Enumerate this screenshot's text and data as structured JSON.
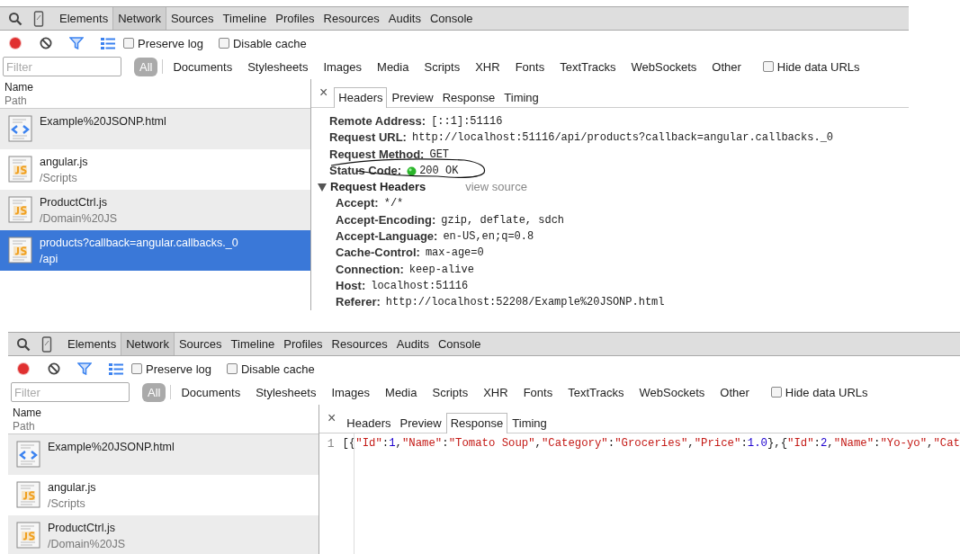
{
  "panels": [
    {
      "main_tabs": [
        {
          "label": "Elements",
          "selected": false
        },
        {
          "label": "Network",
          "selected": true
        },
        {
          "label": "Sources",
          "selected": false
        },
        {
          "label": "Timeline",
          "selected": false
        },
        {
          "label": "Profiles",
          "selected": false
        },
        {
          "label": "Resources",
          "selected": false
        },
        {
          "label": "Audits",
          "selected": false
        },
        {
          "label": "Console",
          "selected": false
        }
      ],
      "checkboxes": [
        {
          "label": "Preserve log",
          "checked": false
        },
        {
          "label": "Disable cache",
          "checked": false
        }
      ],
      "filter": {
        "placeholder": "Filter"
      },
      "type_filters": [
        {
          "label": "All",
          "selected": true
        },
        {
          "label": "Documents",
          "selected": false
        },
        {
          "label": "Stylesheets",
          "selected": false
        },
        {
          "label": "Images",
          "selected": false
        },
        {
          "label": "Media",
          "selected": false
        },
        {
          "label": "Scripts",
          "selected": false
        },
        {
          "label": "XHR",
          "selected": false
        },
        {
          "label": "Fonts",
          "selected": false
        },
        {
          "label": "TextTracks",
          "selected": false
        },
        {
          "label": "WebSockets",
          "selected": false
        },
        {
          "label": "Other",
          "selected": false
        }
      ],
      "hide_data_urls": {
        "label": "Hide data URLs",
        "checked": false
      },
      "list_header": {
        "name": "Name",
        "path": "Path"
      },
      "requests": [
        {
          "name": "Example%20JSONP.html",
          "kind": "html",
          "selected": false
        },
        {
          "name": "angular.js",
          "path": "/Scripts",
          "kind": "js",
          "selected": false
        },
        {
          "name": "ProductCtrl.js",
          "path": "/Domain%20JS",
          "kind": "js",
          "selected": false
        },
        {
          "name": "products?callback=angular.callbacks._0",
          "path": "/api",
          "kind": "js",
          "selected": true
        }
      ],
      "close": "×",
      "detail_tabs": [
        {
          "label": "Headers",
          "selected": true
        },
        {
          "label": "Preview",
          "selected": false
        },
        {
          "label": "Response",
          "selected": false
        },
        {
          "label": "Timing",
          "selected": false
        }
      ],
      "detail": {
        "kind": "headers",
        "general": [
          {
            "label": "Remote Address:",
            "value": "[::1]:51116"
          },
          {
            "label": "Request URL:",
            "value": "http://localhost:51116/api/products?callback=angular.callbacks._0"
          },
          {
            "label": "Request Method:",
            "value": "GET"
          },
          {
            "label": "Status Code:",
            "value": "200 OK",
            "kind": "status"
          }
        ],
        "section": {
          "title": "Request Headers",
          "expanded": true,
          "link": "view source",
          "headers": [
            {
              "label": "Accept:",
              "value": "*/*"
            },
            {
              "label": "Accept-Encoding:",
              "value": "gzip, deflate, sdch"
            },
            {
              "label": "Accept-Language:",
              "value": "en-US,en;q=0.8"
            },
            {
              "label": "Cache-Control:",
              "value": "max-age=0"
            },
            {
              "label": "Connection:",
              "value": "keep-alive"
            },
            {
              "label": "Host:",
              "value": "localhost:51116"
            },
            {
              "label": "Referer:",
              "value": "http://localhost:52208/Example%20JSONP.html"
            }
          ]
        }
      }
    },
    {
      "main_tabs": [
        {
          "label": "Elements",
          "selected": false
        },
        {
          "label": "Network",
          "selected": true
        },
        {
          "label": "Sources",
          "selected": false
        },
        {
          "label": "Timeline",
          "selected": false
        },
        {
          "label": "Profiles",
          "selected": false
        },
        {
          "label": "Resources",
          "selected": false
        },
        {
          "label": "Audits",
          "selected": false
        },
        {
          "label": "Console",
          "selected": false
        }
      ],
      "checkboxes": [
        {
          "label": "Preserve log",
          "checked": false
        },
        {
          "label": "Disable cache",
          "checked": false
        }
      ],
      "filter": {
        "placeholder": "Filter"
      },
      "type_filters": [
        {
          "label": "All",
          "selected": true
        },
        {
          "label": "Documents",
          "selected": false
        },
        {
          "label": "Stylesheets",
          "selected": false
        },
        {
          "label": "Images",
          "selected": false
        },
        {
          "label": "Media",
          "selected": false
        },
        {
          "label": "Scripts",
          "selected": false
        },
        {
          "label": "XHR",
          "selected": false
        },
        {
          "label": "Fonts",
          "selected": false
        },
        {
          "label": "TextTracks",
          "selected": false
        },
        {
          "label": "WebSockets",
          "selected": false
        },
        {
          "label": "Other",
          "selected": false
        }
      ],
      "hide_data_urls": {
        "label": "Hide data URLs",
        "checked": false
      },
      "list_header": {
        "name": "Name",
        "path": "Path"
      },
      "requests": [
        {
          "name": "Example%20JSONP.html",
          "kind": "html",
          "selected": false
        },
        {
          "name": "angular.js",
          "path": "/Scripts",
          "kind": "js",
          "selected": false
        },
        {
          "name": "ProductCtrl.js",
          "path": "/Domain%20JS",
          "kind": "js",
          "selected": false
        }
      ],
      "close": "×",
      "detail_tabs": [
        {
          "label": "Headers",
          "selected": false
        },
        {
          "label": "Preview",
          "selected": false
        },
        {
          "label": "Response",
          "selected": true
        },
        {
          "label": "Timing",
          "selected": false
        }
      ],
      "detail": {
        "kind": "response",
        "lines": [
          {
            "number": "1",
            "tokens": [
              {
                "kind": "punct",
                "text": "[{"
              },
              {
                "kind": "string",
                "text": "\"Id\""
              },
              {
                "kind": "punct",
                "text": ":"
              },
              {
                "kind": "number",
                "text": "1"
              },
              {
                "kind": "punct",
                "text": ","
              },
              {
                "kind": "string",
                "text": "\"Name\""
              },
              {
                "kind": "punct",
                "text": ":"
              },
              {
                "kind": "string",
                "text": "\"Tomato Soup\""
              },
              {
                "kind": "punct",
                "text": ","
              },
              {
                "kind": "string",
                "text": "\"Category\""
              },
              {
                "kind": "punct",
                "text": ":"
              },
              {
                "kind": "string",
                "text": "\"Groceries\""
              },
              {
                "kind": "punct",
                "text": ","
              },
              {
                "kind": "string",
                "text": "\"Price\""
              },
              {
                "kind": "punct",
                "text": ":"
              },
              {
                "kind": "number",
                "text": "1.0"
              },
              {
                "kind": "punct",
                "text": "},{"
              },
              {
                "kind": "string",
                "text": "\"Id\""
              },
              {
                "kind": "punct",
                "text": ":"
              },
              {
                "kind": "number",
                "text": "2"
              },
              {
                "kind": "punct",
                "text": ","
              },
              {
                "kind": "string",
                "text": "\"Name\""
              },
              {
                "kind": "punct",
                "text": ":"
              },
              {
                "kind": "string",
                "text": "\"Yo-yo\""
              },
              {
                "kind": "punct",
                "text": ","
              },
              {
                "kind": "string",
                "text": "\"Cat"
              }
            ]
          }
        ]
      }
    }
  ]
}
